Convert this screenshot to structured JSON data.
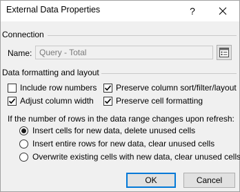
{
  "window": {
    "title": "External Data Properties",
    "help_label": "?",
    "close_label": "✕"
  },
  "connection": {
    "heading": "Connection",
    "name_label": "Name:",
    "name_value": "Query - Total",
    "properties_icon": "connection-properties-icon"
  },
  "formatting": {
    "heading": "Data formatting and layout",
    "checkboxes": [
      {
        "label": "Include row numbers",
        "checked": false
      },
      {
        "label": "Preserve column sort/filter/layout",
        "checked": true
      },
      {
        "label": "Adjust column width",
        "checked": true
      },
      {
        "label": "Preserve cell formatting",
        "checked": true
      }
    ]
  },
  "refresh": {
    "question": "If the number of rows in the data range changes upon refresh:",
    "options": [
      {
        "label": "Insert cells for new data, delete unused cells",
        "selected": true
      },
      {
        "label": "Insert entire rows for new data, clear unused cells",
        "selected": false
      },
      {
        "label": "Overwrite existing cells with new data, clear unused cells",
        "selected": false
      }
    ]
  },
  "buttons": {
    "ok_label": "OK",
    "cancel_label": "Cancel"
  },
  "colors": {
    "dialog_bg": "#f0f0f0",
    "default_button_border": "#0078d7"
  }
}
